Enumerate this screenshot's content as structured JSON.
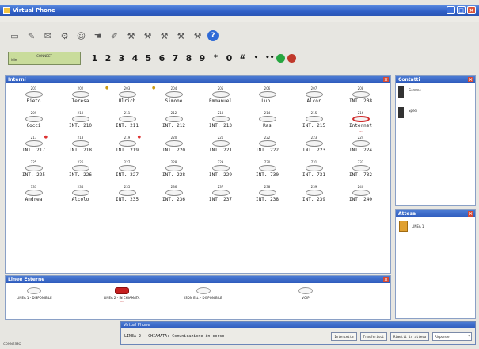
{
  "window": {
    "title": "Virtual Phone"
  },
  "toolbar": {
    "icons": [
      "new-doc-icon",
      "edit-icon",
      "mail-icon",
      "settings-icon",
      "user-icon",
      "hand-icon",
      "pencil-icon",
      "tool-icon",
      "tool-icon",
      "tool-icon",
      "tool-icon",
      "tool-icon",
      "help-icon"
    ],
    "help_label": "?"
  },
  "dialpad": {
    "display_line1": "CONNECT",
    "display_line2": "idle",
    "keys": [
      "1",
      "2",
      "3",
      "4",
      "5",
      "6",
      "7",
      "8",
      "9",
      "*",
      "0",
      "#",
      "•",
      "••"
    ],
    "call_color": "#27a640",
    "hangup_color": "#c0392b"
  },
  "interni": {
    "title": "Interni",
    "extensions": [
      {
        "num": "201",
        "name": "Pieto"
      },
      {
        "num": "202",
        "name": "Teresa"
      },
      {
        "num": "203",
        "name": "Ulrich",
        "flag": "●"
      },
      {
        "num": "204",
        "name": "Simone",
        "flag": "●"
      },
      {
        "num": "205",
        "name": "Emmanuel"
      },
      {
        "num": "206",
        "name": "Lub."
      },
      {
        "num": "207",
        "name": "Alcor"
      },
      {
        "num": "208",
        "name": "INT. 208"
      },
      {
        "num": "209",
        "name": "Cocci"
      },
      {
        "num": "210",
        "name": "INT. 210"
      },
      {
        "num": "211",
        "name": "INT. 211"
      },
      {
        "num": "212",
        "name": "INT. 212"
      },
      {
        "num": "213",
        "name": "INT. 213"
      },
      {
        "num": "214",
        "name": "Ras"
      },
      {
        "num": "215",
        "name": "INT. 215"
      },
      {
        "num": "216",
        "name": "Internet",
        "busy": true,
        "sub": "---"
      },
      {
        "num": "217",
        "name": "INT. 217",
        "flag_red": "●"
      },
      {
        "num": "218",
        "name": "INT. 218"
      },
      {
        "num": "219",
        "name": "INT. 219",
        "flag_red": "●"
      },
      {
        "num": "220",
        "name": "INT. 220"
      },
      {
        "num": "221",
        "name": "INT. 221"
      },
      {
        "num": "222",
        "name": "INT. 222"
      },
      {
        "num": "223",
        "name": "INT. 223"
      },
      {
        "num": "224",
        "name": "INT. 224"
      },
      {
        "num": "225",
        "name": "INT. 225"
      },
      {
        "num": "226",
        "name": "INT. 226"
      },
      {
        "num": "227",
        "name": "INT. 227"
      },
      {
        "num": "228",
        "name": "INT. 228"
      },
      {
        "num": "229",
        "name": "INT. 229"
      },
      {
        "num": "730",
        "name": "INT. 730"
      },
      {
        "num": "731",
        "name": "INT. 731"
      },
      {
        "num": "732",
        "name": "INT. 732"
      },
      {
        "num": "733",
        "name": "Andrea"
      },
      {
        "num": "234",
        "name": "Alcolo"
      },
      {
        "num": "235",
        "name": "INT. 235"
      },
      {
        "num": "236",
        "name": "INT. 236"
      },
      {
        "num": "237",
        "name": "INT. 237"
      },
      {
        "num": "238",
        "name": "INT. 238"
      },
      {
        "num": "239",
        "name": "INT. 239"
      },
      {
        "num": "240",
        "name": "INT. 240"
      }
    ]
  },
  "contatti": {
    "title": "Contatti",
    "items": [
      {
        "name": "Gemme"
      },
      {
        "name": "Spedi"
      }
    ]
  },
  "attesa": {
    "title": "Attesa",
    "items": [
      {
        "label": "LINEA 1"
      }
    ]
  },
  "linee": {
    "title": "Linee Esterne",
    "lines": [
      {
        "label": "LINEA 1 - DISPONIBILE"
      },
      {
        "label": "LINEA 2 - IN CHIAMATA",
        "sub": "---",
        "active": true
      },
      {
        "label": "ISDN Est. - DISPONIBILE"
      },
      {
        "label": "VOIP"
      }
    ]
  },
  "popup": {
    "title": "Virtual Phone",
    "message": "LINEA 2 - CHIAMATA: Comunicazione in corso",
    "buttons": [
      "Intercetta",
      "Trasferisci",
      "Rimetti in attesa"
    ],
    "select_value": "Risponde"
  },
  "statusbar": {
    "text": "CONNESSO"
  }
}
